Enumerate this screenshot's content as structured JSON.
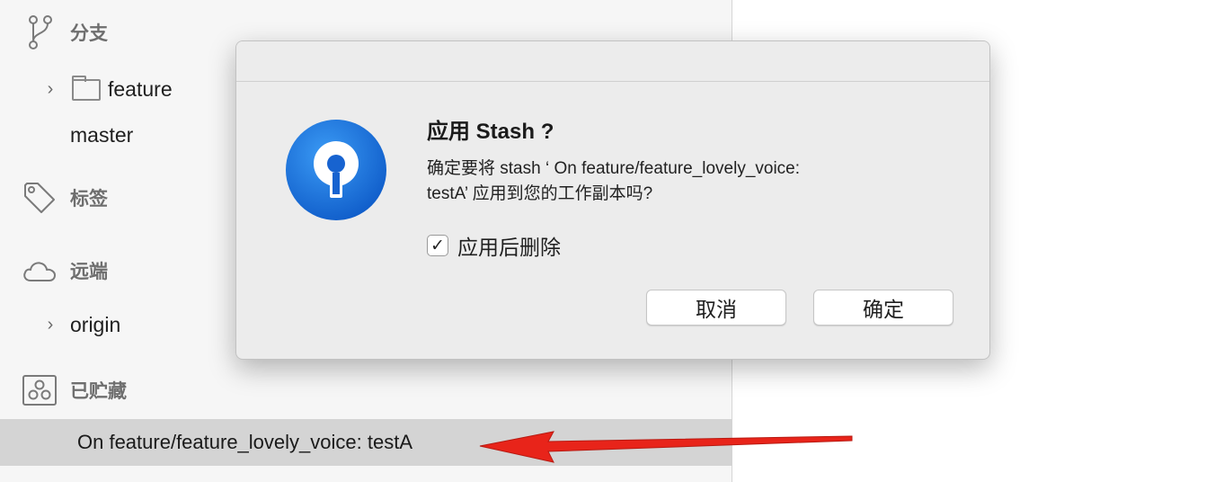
{
  "sidebar": {
    "branches_label": "分支",
    "branch_folder": "feature",
    "branch_master": "master",
    "tags_label": "标签",
    "remotes_label": "远端",
    "remote_origin": "origin",
    "stashes_label": "已贮藏",
    "stash_item": "On feature/feature_lovely_voice: testA"
  },
  "dialog": {
    "title": "应用 Stash ?",
    "message_line1": "确定要将 stash ‘ On feature/feature_lovely_voice:",
    "message_line2": "testA’ 应用到您的工作副本吗?",
    "checkbox_label": "应用后删除",
    "checkbox_checked": true,
    "checkbox_glyph": "✓",
    "cancel_label": "取消",
    "ok_label": "确定"
  },
  "colors": {
    "app_icon_blue": "#1f7ae0",
    "annotation_arrow": "#e8241a"
  }
}
